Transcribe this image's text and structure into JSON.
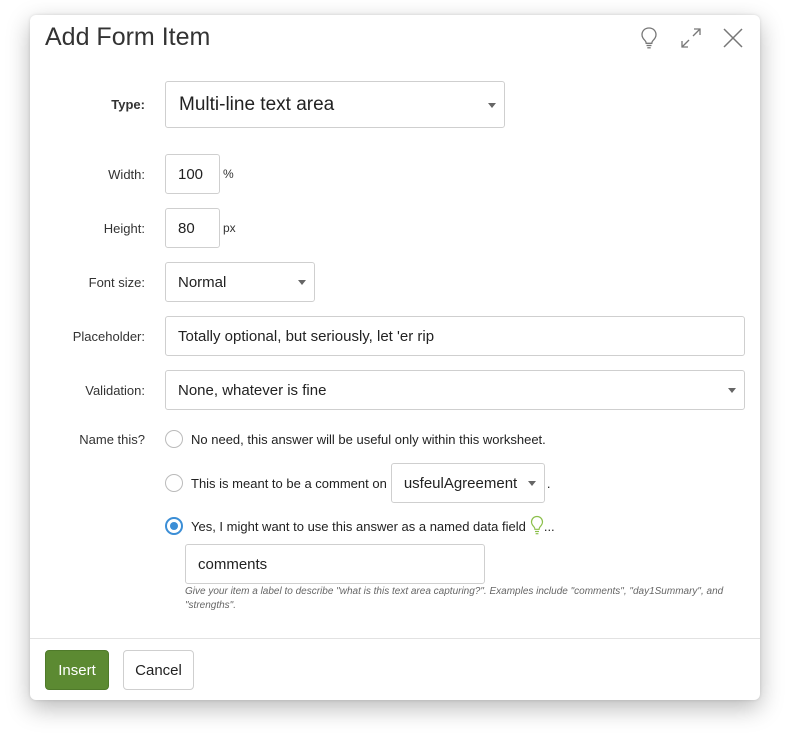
{
  "dialog": {
    "title": "Add Form Item",
    "icons": [
      "lightbulb-icon",
      "expand-icon",
      "close-icon"
    ]
  },
  "form": {
    "type": {
      "label": "Type:",
      "value": "Multi-line text area"
    },
    "width": {
      "label": "Width:",
      "value": "100",
      "unit": "%"
    },
    "height": {
      "label": "Height:",
      "value": "80",
      "unit": "px"
    },
    "font_size": {
      "label": "Font size:",
      "value": "Normal"
    },
    "placeholder": {
      "label": "Placeholder:",
      "value": "Totally optional, but seriously, let 'er rip"
    },
    "validation": {
      "label": "Validation:",
      "value": "None, whatever is fine"
    },
    "name_this": {
      "label": "Name this?",
      "option_none": "No need, this answer will be useful only within this worksheet.",
      "option_comment_before": "This is meant to be a comment on",
      "option_comment_select": "usfeulAgreement",
      "option_comment_after": ".",
      "option_named": "Yes, I might want to use this answer as a named data field",
      "option_named_suffix": "...",
      "field_value": "comments",
      "help_text": "Give your item a label to describe \"what is this text area capturing?\". Examples include \"comments\", \"day1Summary\", and \"strengths\"."
    }
  },
  "footer": {
    "insert_label": "Insert",
    "cancel_label": "Cancel"
  },
  "colors": {
    "primary_button": "#5c8a32",
    "radio_checked": "#3b8ed6",
    "hint_icon": "#8bbf4a"
  }
}
